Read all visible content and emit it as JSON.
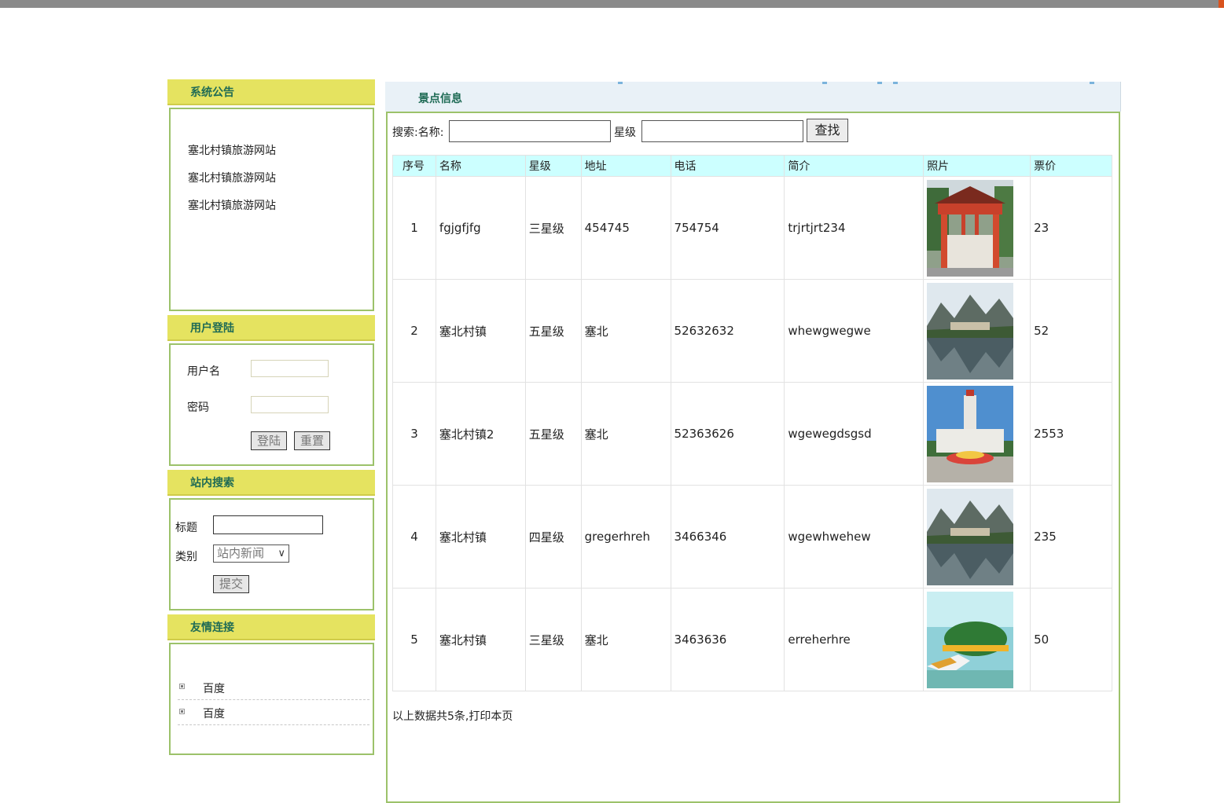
{
  "sidebar": {
    "notice": {
      "title": "系统公告",
      "items": [
        "塞北村镇旅游网站",
        "塞北村镇旅游网站",
        "塞北村镇旅游网站"
      ]
    },
    "login": {
      "title": "用户登陆",
      "username_label": "用户名",
      "password_label": "密码",
      "username_value": "",
      "password_value": "",
      "login_button": "登陆",
      "reset_button": "重置"
    },
    "site_search": {
      "title": "站内搜索",
      "title_label": "标题",
      "category_label": "类别",
      "title_value": "",
      "category_selected": "站内新闻",
      "submit_button": "提交"
    },
    "links": {
      "title": "友情连接",
      "items": [
        "百度",
        "百度"
      ]
    }
  },
  "main": {
    "title": "景点信息",
    "search": {
      "name_label": "搜索:名称:",
      "star_label": "星级",
      "name_value": "",
      "star_value": "",
      "button": "查找"
    },
    "table": {
      "headers": [
        "序号",
        "名称",
        "星级",
        "地址",
        "电话",
        "简介",
        "照片",
        "票价"
      ],
      "rows": [
        {
          "no": "1",
          "name": "fgjgfjfg",
          "star": "三星级",
          "address": "454745",
          "phone": "754754",
          "intro": "trjrtjrt234",
          "photo": "gate-photo",
          "price": "23"
        },
        {
          "no": "2",
          "name": "塞北村镇",
          "star": "五星级",
          "address": "塞北",
          "phone": "52632632",
          "intro": "whewgwegwe",
          "photo": "lake-mountain-photo",
          "price": "52"
        },
        {
          "no": "3",
          "name": "塞北村镇2",
          "star": "五星级",
          "address": "塞北",
          "phone": "52363626",
          "intro": "wgewegdsgsd",
          "photo": "tower-building-photo",
          "price": "2553"
        },
        {
          "no": "4",
          "name": "塞北村镇",
          "star": "四星级",
          "address": "gregerhreh",
          "phone": "3466346",
          "intro": "wgewhwehew",
          "photo": "lake-mountain-photo",
          "price": "235"
        },
        {
          "no": "5",
          "name": "塞北村镇",
          "star": "三星级",
          "address": "塞北",
          "phone": "3463636",
          "intro": "erreherhre",
          "photo": "island-boat-photo",
          "price": "50"
        }
      ]
    },
    "footer_text": "以上数据共5条,打印本页"
  },
  "colors": {
    "panel_header": "#e5e360",
    "panel_border": "#9cc26a",
    "header_text": "#1f6b55",
    "table_header": "#ccffff",
    "main_header_bg": "#e9f1f7"
  }
}
